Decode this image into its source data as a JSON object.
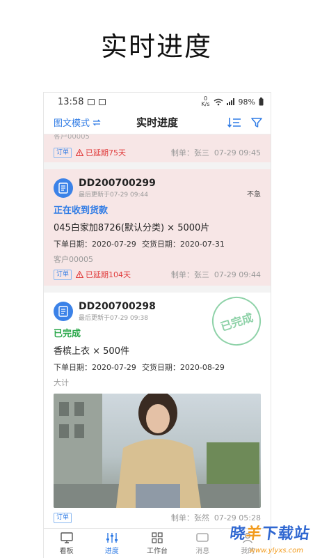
{
  "headline": "实时进度",
  "status_bar": {
    "time": "13:58",
    "speed_num": "0",
    "speed_unit": "K/s",
    "battery": "98%"
  },
  "app_bar": {
    "mode_label": "图文模式",
    "title": "实时进度"
  },
  "orders": [
    {
      "partial_text": "客户00005",
      "tag": "订单",
      "delay": "已延期75天",
      "maker": "制单：张三",
      "time": "07-29 09:45"
    },
    {
      "order_no": "DD200700299",
      "updated": "最后更新于07-29 09:44",
      "urgency": "不急",
      "status": "正在收到货款",
      "product": "045白家加8726(默认分类) × 5000片",
      "order_date": "下单日期：2020-07-29",
      "delivery_date": "交货日期：2020-07-31",
      "customer": "客户00005",
      "tag": "订单",
      "delay": "已延期104天",
      "maker": "制单：张三",
      "time": "07-29 09:44"
    },
    {
      "order_no": "DD200700298",
      "updated": "最后更新于07-29 09:38",
      "stamp": "已完成",
      "status": "已完成",
      "product": "香槟上衣 × 500件",
      "order_date": "下单日期：2020-07-29",
      "delivery_date": "交货日期：2020-08-29",
      "customer": "大计",
      "tag": "订单",
      "maker": "制单：张然",
      "time": "07-29 05:28"
    }
  ],
  "nav": [
    {
      "label": "看板",
      "icon": "monitor-icon"
    },
    {
      "label": "进度",
      "icon": "sliders-icon"
    },
    {
      "label": "工作台",
      "icon": "grid-icon"
    },
    {
      "label": "消息",
      "icon": "message-icon"
    },
    {
      "label": "我的",
      "icon": "user-icon"
    }
  ],
  "watermark": {
    "text_a": "晓",
    "text_b": "羊",
    "text_c": "下载站",
    "url": "www.ylyxs.com"
  },
  "colors": {
    "accent": "#2f7be5",
    "delay_red": "#e03b3b",
    "done_green": "#2aa84a",
    "delayed_bg": "#f7e6e6"
  }
}
